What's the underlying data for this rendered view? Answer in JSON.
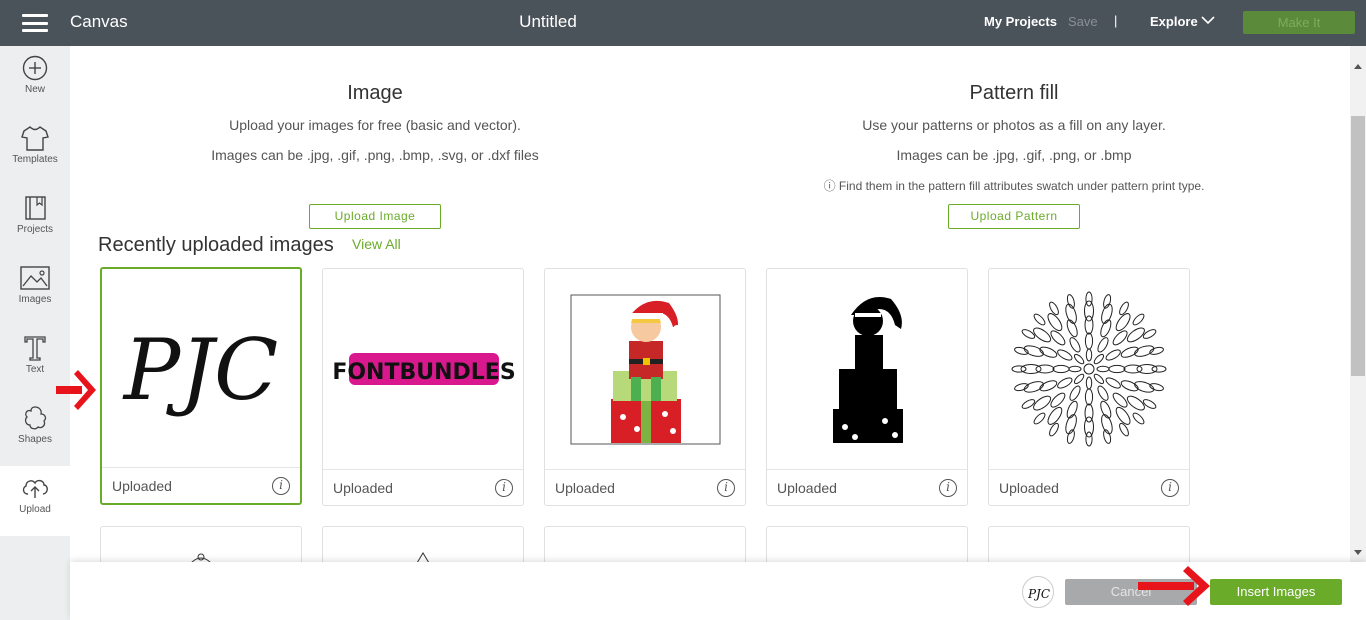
{
  "topbar": {
    "app_title": "Canvas",
    "doc_title": "Untitled",
    "my_projects": "My Projects",
    "save": "Save",
    "separator": "|",
    "explore": "Explore",
    "make_it": "Make It",
    "colors": {
      "bar": "#4a525a",
      "make_it_bg": "#5a8a3a"
    }
  },
  "sidebar": {
    "items": [
      {
        "label": "New",
        "icon": "plus-circle-icon"
      },
      {
        "label": "Templates",
        "icon": "tshirt-icon"
      },
      {
        "label": "Projects",
        "icon": "book-icon"
      },
      {
        "label": "Images",
        "icon": "image-icon"
      },
      {
        "label": "Text",
        "icon": "text-t-icon"
      },
      {
        "label": "Shapes",
        "icon": "shapes-icon"
      },
      {
        "label": "Upload",
        "icon": "cloud-upload-icon",
        "active": true
      }
    ]
  },
  "image_section": {
    "title": "Image",
    "line1": "Upload your images for free (basic and vector).",
    "line2": "Images can be .jpg, .gif, .png, .bmp, .svg, or .dxf files",
    "button": "Upload Image"
  },
  "pattern_section": {
    "title": "Pattern fill",
    "line1": "Use your patterns or photos as a fill on any layer.",
    "line2": "Images can be .jpg, .gif, .png, or .bmp",
    "note": "ⓘ Find them in the pattern fill attributes swatch under pattern print type.",
    "button": "Upload Pattern"
  },
  "recent": {
    "title": "Recently uploaded images",
    "view_all": "View All",
    "cards": [
      {
        "label": "Uploaded",
        "thumb": "pjc-monogram",
        "selected": true,
        "thumb_text": "PJC"
      },
      {
        "label": "Uploaded",
        "thumb": "fontbundles-logo",
        "thumb_text": "FONTBUNDLES"
      },
      {
        "label": "Uploaded",
        "thumb": "elf-color"
      },
      {
        "label": "Uploaded",
        "thumb": "elf-silhouette"
      },
      {
        "label": "Uploaded",
        "thumb": "mandala"
      }
    ]
  },
  "bottombar": {
    "mini_text": "PJC",
    "cancel": "Cancel",
    "insert": "Insert Images"
  },
  "accent_color": "#6aab2a",
  "arrow_color": "#e8141b"
}
